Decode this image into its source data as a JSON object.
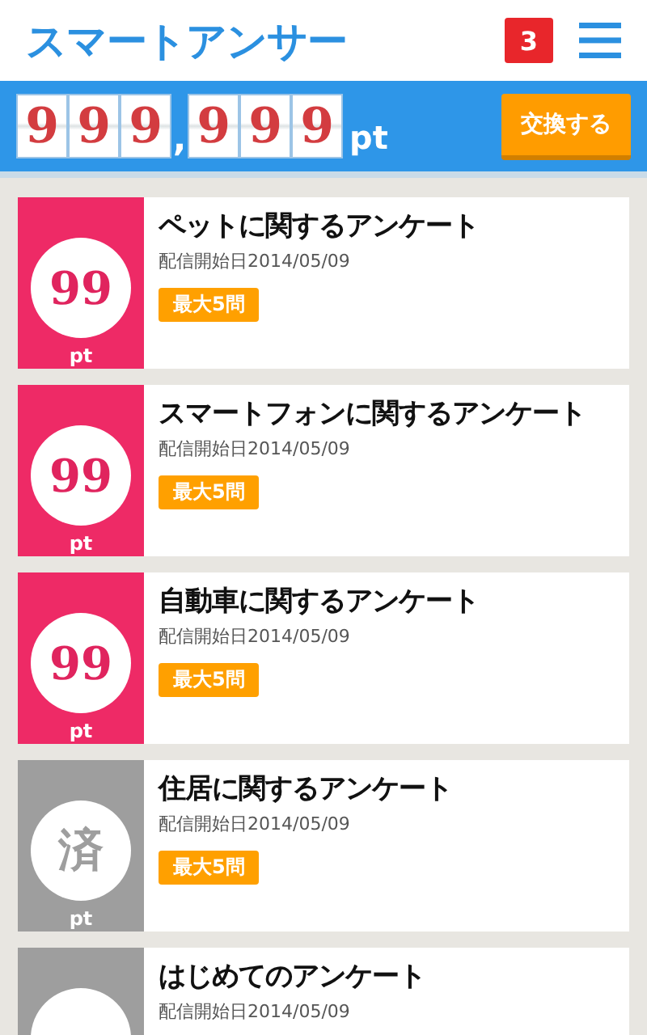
{
  "header": {
    "logo": "スマートアンサー",
    "notification_count": "3"
  },
  "points_bar": {
    "counter": [
      "9",
      "9",
      "9",
      ",",
      "9",
      "9",
      "9"
    ],
    "unit": "pt",
    "exchange_button": "交換する"
  },
  "surveys": [
    {
      "kind": "open",
      "reward": "99",
      "unit": "pt",
      "title": "ペットに関するアンケート",
      "date": "配信開始日2014/05/09",
      "badge": "最大5問"
    },
    {
      "kind": "open",
      "reward": "99",
      "unit": "pt",
      "title": "スマートフォンに関するアンケート",
      "date": "配信開始日2014/05/09",
      "badge": "最大5問"
    },
    {
      "kind": "open",
      "reward": "99",
      "unit": "pt",
      "title": "自動車に関するアンケート",
      "date": "配信開始日2014/05/09",
      "badge": "最大5問"
    },
    {
      "kind": "done",
      "reward": "済",
      "unit": "pt",
      "title": "住居に関するアンケート",
      "date": "配信開始日2014/05/09",
      "badge": "最大5問"
    },
    {
      "kind": "done",
      "title": "はじめてのアンケート",
      "date": "配信開始日2014/05/09"
    }
  ]
}
